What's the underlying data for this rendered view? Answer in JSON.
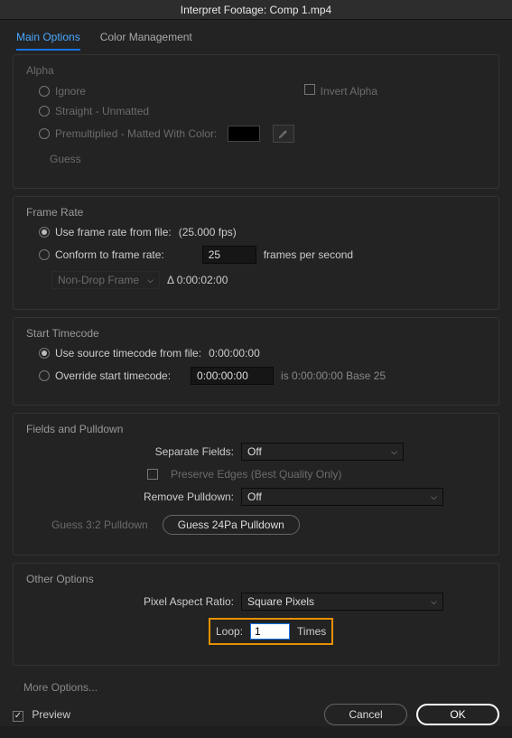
{
  "title": "Interpret Footage: Comp 1.mp4",
  "tabs": {
    "main": "Main Options",
    "color": "Color Management"
  },
  "alpha": {
    "title": "Alpha",
    "ignore": "Ignore",
    "invert": "Invert Alpha",
    "straight": "Straight - Unmatted",
    "premult": "Premultiplied - Matted With Color:",
    "guess": "Guess"
  },
  "frame": {
    "title": "Frame Rate",
    "fromfile": "Use frame rate from file:",
    "fromfile_val": "(25.000 fps)",
    "conform": "Conform to frame rate:",
    "conform_val": "25",
    "fps_suffix": "frames per second",
    "drop": "Non-Drop Frame",
    "delta": "Δ 0:00:02:00"
  },
  "timecode": {
    "title": "Start Timecode",
    "source": "Use source timecode from file:",
    "source_val": "0:00:00:00",
    "override": "Override start timecode:",
    "override_val": "0:00:00:00",
    "info": "is 0:00:00:00  Base 25"
  },
  "fields": {
    "title": "Fields and Pulldown",
    "sep": "Separate Fields:",
    "sep_val": "Off",
    "preserve": "Preserve Edges (Best Quality Only)",
    "remove": "Remove Pulldown:",
    "remove_val": "Off",
    "g32": "Guess 3:2 Pulldown",
    "g24": "Guess 24Pa Pulldown"
  },
  "other": {
    "title": "Other Options",
    "par": "Pixel Aspect Ratio:",
    "par_val": "Square Pixels",
    "loop_lbl": "Loop:",
    "loop_val": "1",
    "loop_suffix": "Times"
  },
  "footer": {
    "more": "More Options...",
    "preview": "Preview",
    "cancel": "Cancel",
    "ok": "OK"
  }
}
